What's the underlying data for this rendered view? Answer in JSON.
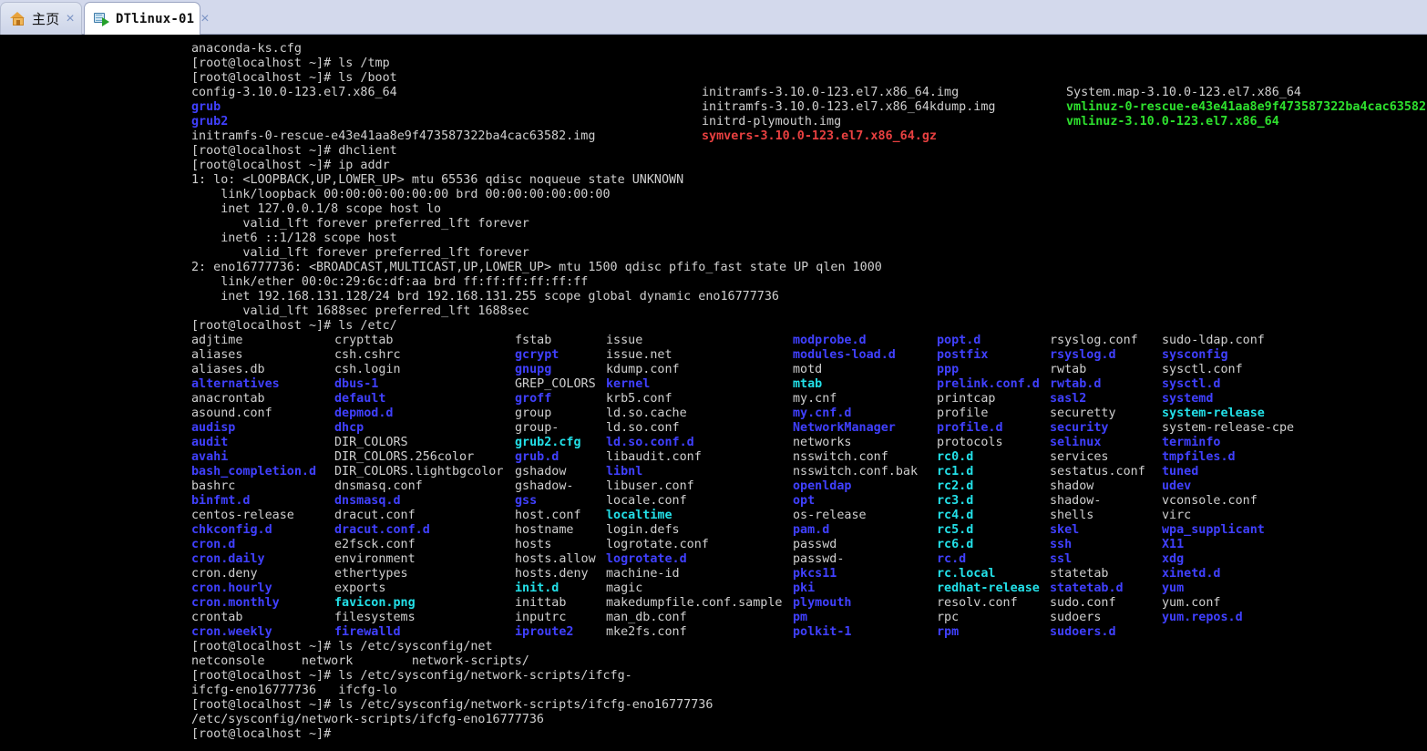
{
  "window": {
    "tabs": [
      {
        "label": "主页",
        "icon": "home-icon",
        "active": false,
        "close_label": "×"
      },
      {
        "label": "DTlinux-01",
        "icon": "vm-console-icon",
        "active": true,
        "close_label": "×"
      }
    ]
  },
  "colors": {
    "tabbar_bg": "#d3d9ec",
    "active_tab_bg": "#ffffff",
    "terminal_bg": "#000000",
    "fg_default": "#cfcfcf",
    "fg_directory": "#4040ff",
    "fg_symlink": "#23e0e8",
    "fg_executable": "#2ee02e",
    "fg_archive": "#e84040"
  },
  "terminal": {
    "prompt": "[root@localhost ~]#",
    "preamble": [
      {
        "text": "anaconda-ks.cfg",
        "color": "white"
      },
      {
        "text": "[root@localhost ~]# ls /tmp",
        "color": "white"
      },
      {
        "text": "[root@localhost ~]# ls /boot",
        "color": "white"
      }
    ],
    "boot_listing": {
      "columns_x": [
        0,
        560,
        960
      ],
      "rows": [
        [
          {
            "text": "config-3.10.0-123.el7.x86_64",
            "color": "white"
          },
          {
            "text": "initramfs-3.10.0-123.el7.x86_64.img",
            "color": "white"
          },
          {
            "text": "System.map-3.10.0-123.el7.x86_64",
            "color": "white"
          }
        ],
        [
          {
            "text": "grub",
            "color": "blue"
          },
          {
            "text": "initramfs-3.10.0-123.el7.x86_64kdump.img",
            "color": "white"
          },
          {
            "text": "vmlinuz-0-rescue-e43e41aa8e9f473587322ba4cac63582",
            "color": "green"
          }
        ],
        [
          {
            "text": "grub2",
            "color": "blue"
          },
          {
            "text": "initrd-plymouth.img",
            "color": "white"
          },
          {
            "text": "vmlinuz-3.10.0-123.el7.x86_64",
            "color": "green"
          }
        ],
        [
          {
            "text": "initramfs-0-rescue-e43e41aa8e9f473587322ba4cac63582.img",
            "color": "white"
          },
          {
            "text": "symvers-3.10.0-123.el7.x86_64.gz",
            "color": "red"
          },
          {
            "text": "",
            "color": "white"
          }
        ]
      ]
    },
    "ipaddr_block": [
      {
        "text": "[root@localhost ~]# dhclient",
        "color": "white"
      },
      {
        "text": "[root@localhost ~]# ip addr",
        "color": "white"
      },
      {
        "text": "1: lo: <LOOPBACK,UP,LOWER_UP> mtu 65536 qdisc noqueue state UNKNOWN",
        "color": "white"
      },
      {
        "text": "    link/loopback 00:00:00:00:00:00 brd 00:00:00:00:00:00",
        "color": "white"
      },
      {
        "text": "    inet 127.0.0.1/8 scope host lo",
        "color": "white"
      },
      {
        "text": "       valid_lft forever preferred_lft forever",
        "color": "white"
      },
      {
        "text": "    inet6 ::1/128 scope host",
        "color": "white"
      },
      {
        "text": "       valid_lft forever preferred_lft forever",
        "color": "white"
      },
      {
        "text": "2: eno16777736: <BROADCAST,MULTICAST,UP,LOWER_UP> mtu 1500 qdisc pfifo_fast state UP qlen 1000",
        "color": "white"
      },
      {
        "text": "    link/ether 00:0c:29:6c:df:aa brd ff:ff:ff:ff:ff:ff",
        "color": "white"
      },
      {
        "text": "    inet 192.168.131.128/24 brd 192.168.131.255 scope global dynamic eno16777736",
        "color": "white"
      },
      {
        "text": "       valid_lft 1688sec preferred_lft 1688sec",
        "color": "white"
      },
      {
        "text": "[root@localhost ~]# ls /etc/",
        "color": "white"
      }
    ],
    "etc_listing": {
      "command": "[root@localhost ~]# ls /etc/",
      "columns_x": [
        0,
        157,
        355,
        455,
        660,
        818,
        942,
        1065
      ],
      "columns": [
        [
          {
            "text": "adjtime",
            "color": "white"
          },
          {
            "text": "aliases",
            "color": "white"
          },
          {
            "text": "aliases.db",
            "color": "white"
          },
          {
            "text": "alternatives",
            "color": "blue"
          },
          {
            "text": "anacrontab",
            "color": "white"
          },
          {
            "text": "asound.conf",
            "color": "white"
          },
          {
            "text": "audisp",
            "color": "blue"
          },
          {
            "text": "audit",
            "color": "blue"
          },
          {
            "text": "avahi",
            "color": "blue"
          },
          {
            "text": "bash_completion.d",
            "color": "blue"
          },
          {
            "text": "bashrc",
            "color": "white"
          },
          {
            "text": "binfmt.d",
            "color": "blue"
          },
          {
            "text": "centos-release",
            "color": "white"
          },
          {
            "text": "chkconfig.d",
            "color": "blue"
          },
          {
            "text": "cron.d",
            "color": "blue"
          },
          {
            "text": "cron.daily",
            "color": "blue"
          },
          {
            "text": "cron.deny",
            "color": "white"
          },
          {
            "text": "cron.hourly",
            "color": "blue"
          },
          {
            "text": "cron.monthly",
            "color": "blue"
          },
          {
            "text": "crontab",
            "color": "white"
          },
          {
            "text": "cron.weekly",
            "color": "blue"
          }
        ],
        [
          {
            "text": "crypttab",
            "color": "white"
          },
          {
            "text": "csh.cshrc",
            "color": "white"
          },
          {
            "text": "csh.login",
            "color": "white"
          },
          {
            "text": "dbus-1",
            "color": "blue"
          },
          {
            "text": "default",
            "color": "blue"
          },
          {
            "text": "depmod.d",
            "color": "blue"
          },
          {
            "text": "dhcp",
            "color": "blue"
          },
          {
            "text": "DIR_COLORS",
            "color": "white"
          },
          {
            "text": "DIR_COLORS.256color",
            "color": "white"
          },
          {
            "text": "DIR_COLORS.lightbgcolor",
            "color": "white"
          },
          {
            "text": "dnsmasq.conf",
            "color": "white"
          },
          {
            "text": "dnsmasq.d",
            "color": "blue"
          },
          {
            "text": "dracut.conf",
            "color": "white"
          },
          {
            "text": "dracut.conf.d",
            "color": "blue"
          },
          {
            "text": "e2fsck.conf",
            "color": "white"
          },
          {
            "text": "environment",
            "color": "white"
          },
          {
            "text": "ethertypes",
            "color": "white"
          },
          {
            "text": "exports",
            "color": "white"
          },
          {
            "text": "favicon.png",
            "color": "cyan"
          },
          {
            "text": "filesystems",
            "color": "white"
          },
          {
            "text": "firewalld",
            "color": "blue"
          }
        ],
        [
          {
            "text": "fstab",
            "color": "white"
          },
          {
            "text": "gcrypt",
            "color": "blue"
          },
          {
            "text": "gnupg",
            "color": "blue"
          },
          {
            "text": "GREP_COLORS",
            "color": "white"
          },
          {
            "text": "groff",
            "color": "blue"
          },
          {
            "text": "group",
            "color": "white"
          },
          {
            "text": "group-",
            "color": "white"
          },
          {
            "text": "grub2.cfg",
            "color": "cyan"
          },
          {
            "text": "grub.d",
            "color": "blue"
          },
          {
            "text": "gshadow",
            "color": "white"
          },
          {
            "text": "gshadow-",
            "color": "white"
          },
          {
            "text": "gss",
            "color": "blue"
          },
          {
            "text": "host.conf",
            "color": "white"
          },
          {
            "text": "hostname",
            "color": "white"
          },
          {
            "text": "hosts",
            "color": "white"
          },
          {
            "text": "hosts.allow",
            "color": "white"
          },
          {
            "text": "hosts.deny",
            "color": "white"
          },
          {
            "text": "init.d",
            "color": "cyan"
          },
          {
            "text": "inittab",
            "color": "white"
          },
          {
            "text": "inputrc",
            "color": "white"
          },
          {
            "text": "iproute2",
            "color": "blue"
          }
        ],
        [
          {
            "text": "issue",
            "color": "white"
          },
          {
            "text": "issue.net",
            "color": "white"
          },
          {
            "text": "kdump.conf",
            "color": "white"
          },
          {
            "text": "kernel",
            "color": "blue"
          },
          {
            "text": "krb5.conf",
            "color": "white"
          },
          {
            "text": "ld.so.cache",
            "color": "white"
          },
          {
            "text": "ld.so.conf",
            "color": "white"
          },
          {
            "text": "ld.so.conf.d",
            "color": "blue"
          },
          {
            "text": "libaudit.conf",
            "color": "white"
          },
          {
            "text": "libnl",
            "color": "blue"
          },
          {
            "text": "libuser.conf",
            "color": "white"
          },
          {
            "text": "locale.conf",
            "color": "white"
          },
          {
            "text": "localtime",
            "color": "cyan"
          },
          {
            "text": "login.defs",
            "color": "white"
          },
          {
            "text": "logrotate.conf",
            "color": "white"
          },
          {
            "text": "logrotate.d",
            "color": "blue"
          },
          {
            "text": "machine-id",
            "color": "white"
          },
          {
            "text": "magic",
            "color": "white"
          },
          {
            "text": "makedumpfile.conf.sample",
            "color": "white"
          },
          {
            "text": "man_db.conf",
            "color": "white"
          },
          {
            "text": "mke2fs.conf",
            "color": "white"
          }
        ],
        [
          {
            "text": "modprobe.d",
            "color": "blue"
          },
          {
            "text": "modules-load.d",
            "color": "blue"
          },
          {
            "text": "motd",
            "color": "white"
          },
          {
            "text": "mtab",
            "color": "cyan"
          },
          {
            "text": "my.cnf",
            "color": "white"
          },
          {
            "text": "my.cnf.d",
            "color": "blue"
          },
          {
            "text": "NetworkManager",
            "color": "blue"
          },
          {
            "text": "networks",
            "color": "white"
          },
          {
            "text": "nsswitch.conf",
            "color": "white"
          },
          {
            "text": "nsswitch.conf.bak",
            "color": "white"
          },
          {
            "text": "openldap",
            "color": "blue"
          },
          {
            "text": "opt",
            "color": "blue"
          },
          {
            "text": "os-release",
            "color": "white"
          },
          {
            "text": "pam.d",
            "color": "blue"
          },
          {
            "text": "passwd",
            "color": "white"
          },
          {
            "text": "passwd-",
            "color": "white"
          },
          {
            "text": "pkcs11",
            "color": "blue"
          },
          {
            "text": "pki",
            "color": "blue"
          },
          {
            "text": "plymouth",
            "color": "blue"
          },
          {
            "text": "pm",
            "color": "blue"
          },
          {
            "text": "polkit-1",
            "color": "blue"
          }
        ],
        [
          {
            "text": "popt.d",
            "color": "blue"
          },
          {
            "text": "postfix",
            "color": "blue"
          },
          {
            "text": "ppp",
            "color": "blue"
          },
          {
            "text": "prelink.conf.d",
            "color": "blue"
          },
          {
            "text": "printcap",
            "color": "white"
          },
          {
            "text": "profile",
            "color": "white"
          },
          {
            "text": "profile.d",
            "color": "blue"
          },
          {
            "text": "protocols",
            "color": "white"
          },
          {
            "text": "rc0.d",
            "color": "cyan"
          },
          {
            "text": "rc1.d",
            "color": "cyan"
          },
          {
            "text": "rc2.d",
            "color": "cyan"
          },
          {
            "text": "rc3.d",
            "color": "cyan"
          },
          {
            "text": "rc4.d",
            "color": "cyan"
          },
          {
            "text": "rc5.d",
            "color": "cyan"
          },
          {
            "text": "rc6.d",
            "color": "cyan"
          },
          {
            "text": "rc.d",
            "color": "blue"
          },
          {
            "text": "rc.local",
            "color": "cyan"
          },
          {
            "text": "redhat-release",
            "color": "cyan"
          },
          {
            "text": "resolv.conf",
            "color": "white"
          },
          {
            "text": "rpc",
            "color": "white"
          },
          {
            "text": "rpm",
            "color": "blue"
          }
        ],
        [
          {
            "text": "rsyslog.conf",
            "color": "white"
          },
          {
            "text": "rsyslog.d",
            "color": "blue"
          },
          {
            "text": "rwtab",
            "color": "white"
          },
          {
            "text": "rwtab.d",
            "color": "blue"
          },
          {
            "text": "sasl2",
            "color": "blue"
          },
          {
            "text": "securetty",
            "color": "white"
          },
          {
            "text": "security",
            "color": "blue"
          },
          {
            "text": "selinux",
            "color": "blue"
          },
          {
            "text": "services",
            "color": "white"
          },
          {
            "text": "sestatus.conf",
            "color": "white"
          },
          {
            "text": "shadow",
            "color": "white"
          },
          {
            "text": "shadow-",
            "color": "white"
          },
          {
            "text": "shells",
            "color": "white"
          },
          {
            "text": "skel",
            "color": "blue"
          },
          {
            "text": "ssh",
            "color": "blue"
          },
          {
            "text": "ssl",
            "color": "blue"
          },
          {
            "text": "statetab",
            "color": "white"
          },
          {
            "text": "statetab.d",
            "color": "blue"
          },
          {
            "text": "sudo.conf",
            "color": "white"
          },
          {
            "text": "sudoers",
            "color": "white"
          },
          {
            "text": "sudoers.d",
            "color": "blue"
          }
        ],
        [
          {
            "text": "sudo-ldap.conf",
            "color": "white"
          },
          {
            "text": "sysconfig",
            "color": "blue"
          },
          {
            "text": "sysctl.conf",
            "color": "white"
          },
          {
            "text": "sysctl.d",
            "color": "blue"
          },
          {
            "text": "systemd",
            "color": "blue"
          },
          {
            "text": "system-release",
            "color": "cyan"
          },
          {
            "text": "system-release-cpe",
            "color": "white"
          },
          {
            "text": "terminfo",
            "color": "blue"
          },
          {
            "text": "tmpfiles.d",
            "color": "blue"
          },
          {
            "text": "tuned",
            "color": "blue"
          },
          {
            "text": "udev",
            "color": "blue"
          },
          {
            "text": "vconsole.conf",
            "color": "white"
          },
          {
            "text": "virc",
            "color": "white"
          },
          {
            "text": "wpa_supplicant",
            "color": "blue"
          },
          {
            "text": "X11",
            "color": "blue"
          },
          {
            "text": "xdg",
            "color": "blue"
          },
          {
            "text": "xinetd.d",
            "color": "blue"
          },
          {
            "text": "yum",
            "color": "blue"
          },
          {
            "text": "yum.conf",
            "color": "white"
          },
          {
            "text": "yum.repos.d",
            "color": "blue"
          }
        ]
      ]
    },
    "epilogue": [
      {
        "text": "[root@localhost ~]# ls /etc/sysconfig/net",
        "color": "white"
      },
      {
        "text": "netconsole     network        network-scripts/",
        "color": "white"
      },
      {
        "text": "[root@localhost ~]# ls /etc/sysconfig/network-scripts/ifcfg-",
        "color": "white"
      },
      {
        "text": "ifcfg-eno16777736   ifcfg-lo",
        "color": "white"
      },
      {
        "text": "[root@localhost ~]# ls /etc/sysconfig/network-scripts/ifcfg-eno16777736",
        "color": "white"
      },
      {
        "text": "/etc/sysconfig/network-scripts/ifcfg-eno16777736",
        "color": "white"
      },
      {
        "text": "[root@localhost ~]#",
        "color": "white"
      }
    ]
  }
}
